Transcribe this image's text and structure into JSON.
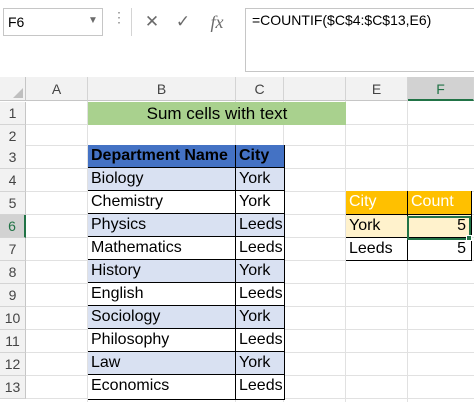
{
  "name_box": "F6",
  "formula": "=COUNTIF($C$4:$C$13,E6)",
  "formula_buttons": {
    "cancel": "✕",
    "enter": "✓",
    "fx": "fx"
  },
  "columns": [
    "A",
    "B",
    "C",
    "E",
    "F"
  ],
  "rows": [
    "1",
    "2",
    "3",
    "4",
    "5",
    "6",
    "7",
    "8",
    "9",
    "10",
    "11",
    "12",
    "13"
  ],
  "title": "Sum cells with text",
  "table": {
    "headers": [
      "Department Name",
      "City"
    ],
    "rows": [
      [
        "Biology",
        "York"
      ],
      [
        "Chemistry",
        "York"
      ],
      [
        "Physics",
        "Leeds"
      ],
      [
        "Mathematics",
        "Leeds"
      ],
      [
        "History",
        "York"
      ],
      [
        "English",
        "Leeds"
      ],
      [
        "Sociology",
        "York"
      ],
      [
        "Philosophy",
        "Leeds"
      ],
      [
        "Law",
        "York"
      ],
      [
        "Economics",
        "Leeds"
      ]
    ]
  },
  "lookup": {
    "headers": [
      "City",
      "Count"
    ],
    "rows": [
      [
        "York",
        "5"
      ],
      [
        "Leeds",
        "5"
      ]
    ]
  },
  "active_cell": {
    "column": "F",
    "row": "6"
  },
  "colors": {
    "title_fill": "#a9d18e",
    "table_header": "#4472c4",
    "table_band": "#d9e1f2",
    "lookup_header": "#ffc000",
    "lookup_highlight": "#fff2cc",
    "selection": "#217346"
  }
}
